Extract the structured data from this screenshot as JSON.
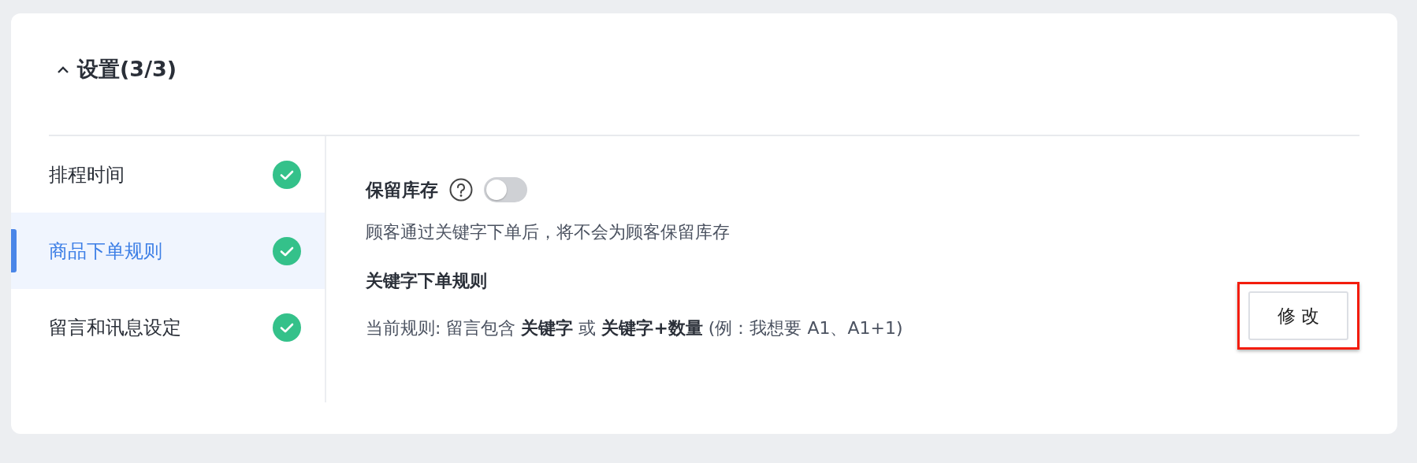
{
  "section": {
    "title": "设置(3/3)",
    "expanded": true
  },
  "sidebar": {
    "items": [
      {
        "label": "排程时间",
        "selected": false,
        "done": true
      },
      {
        "label": "商品下单规则",
        "selected": true,
        "done": true
      },
      {
        "label": "留言和讯息设定",
        "selected": false,
        "done": true
      }
    ]
  },
  "content": {
    "reserve_stock": {
      "label": "保留库存",
      "on": false
    },
    "description": "顾客通过关键字下单后，将不会为顾客保留库存",
    "rule_heading": "关键字下单规则",
    "rule_text": "当前规则: 留言包含 **关键字** 或 **关键字+数量** (例：我想要 A1、A1+1)",
    "edit_button": {
      "label": "修 改",
      "highlighted": true
    }
  }
}
